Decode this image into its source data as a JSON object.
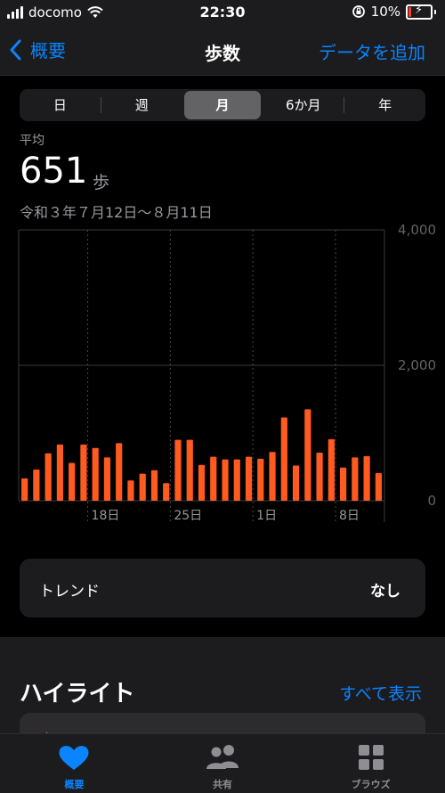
{
  "status_bar": {
    "carrier": "docomo",
    "time": "22:30",
    "battery": "10%"
  },
  "nav": {
    "back_label": "概要",
    "title": "歩数",
    "action": "データを追加"
  },
  "segments": [
    {
      "label": "日",
      "active": false
    },
    {
      "label": "週",
      "active": false
    },
    {
      "label": "月",
      "active": true
    },
    {
      "label": "6か月",
      "active": false
    },
    {
      "label": "年",
      "active": false
    }
  ],
  "summary": {
    "label": "平均",
    "value": "651",
    "unit": "歩",
    "date_range": "令和３年７月12日〜８月11日"
  },
  "chart_data": {
    "type": "bar",
    "categories": [
      "7/12",
      "7/13",
      "7/14",
      "7/15",
      "7/16",
      "7/17",
      "7/18",
      "7/19",
      "7/20",
      "7/21",
      "7/22",
      "7/23",
      "7/24",
      "7/25",
      "7/26",
      "7/27",
      "7/28",
      "7/29",
      "7/30",
      "7/31",
      "8/1",
      "8/2",
      "8/3",
      "8/4",
      "8/5",
      "8/6",
      "8/7",
      "8/8",
      "8/9",
      "8/10",
      "8/11"
    ],
    "values": [
      330,
      460,
      700,
      830,
      560,
      830,
      780,
      640,
      850,
      300,
      400,
      450,
      260,
      900,
      900,
      530,
      650,
      610,
      610,
      650,
      620,
      720,
      1230,
      520,
      1350,
      710,
      910,
      490,
      640,
      660,
      410
    ],
    "tick_labels": [
      {
        "index": 6,
        "label": "18日"
      },
      {
        "index": 13,
        "label": "25日"
      },
      {
        "index": 20,
        "label": "1日"
      },
      {
        "index": 27,
        "label": "8日"
      }
    ],
    "y_ticks": [
      {
        "value": 4000,
        "label": "4,000"
      },
      {
        "value": 2000,
        "label": "2,000"
      },
      {
        "value": 0,
        "label": "0"
      }
    ],
    "ylim": [
      0,
      4000
    ],
    "bar_color": "#ff5a1f"
  },
  "trend": {
    "label": "トレンド",
    "value": "なし"
  },
  "highlights": {
    "title": "ハイライト",
    "show_all": "すべて表示"
  },
  "tabs": [
    {
      "label": "概要",
      "icon": "heart-icon",
      "active": true
    },
    {
      "label": "共有",
      "icon": "people-icon",
      "active": false
    },
    {
      "label": "ブラウズ",
      "icon": "grid-icon",
      "active": false
    }
  ],
  "colors": {
    "accent": "#0a84ff",
    "bar": "#ff5a1f"
  }
}
